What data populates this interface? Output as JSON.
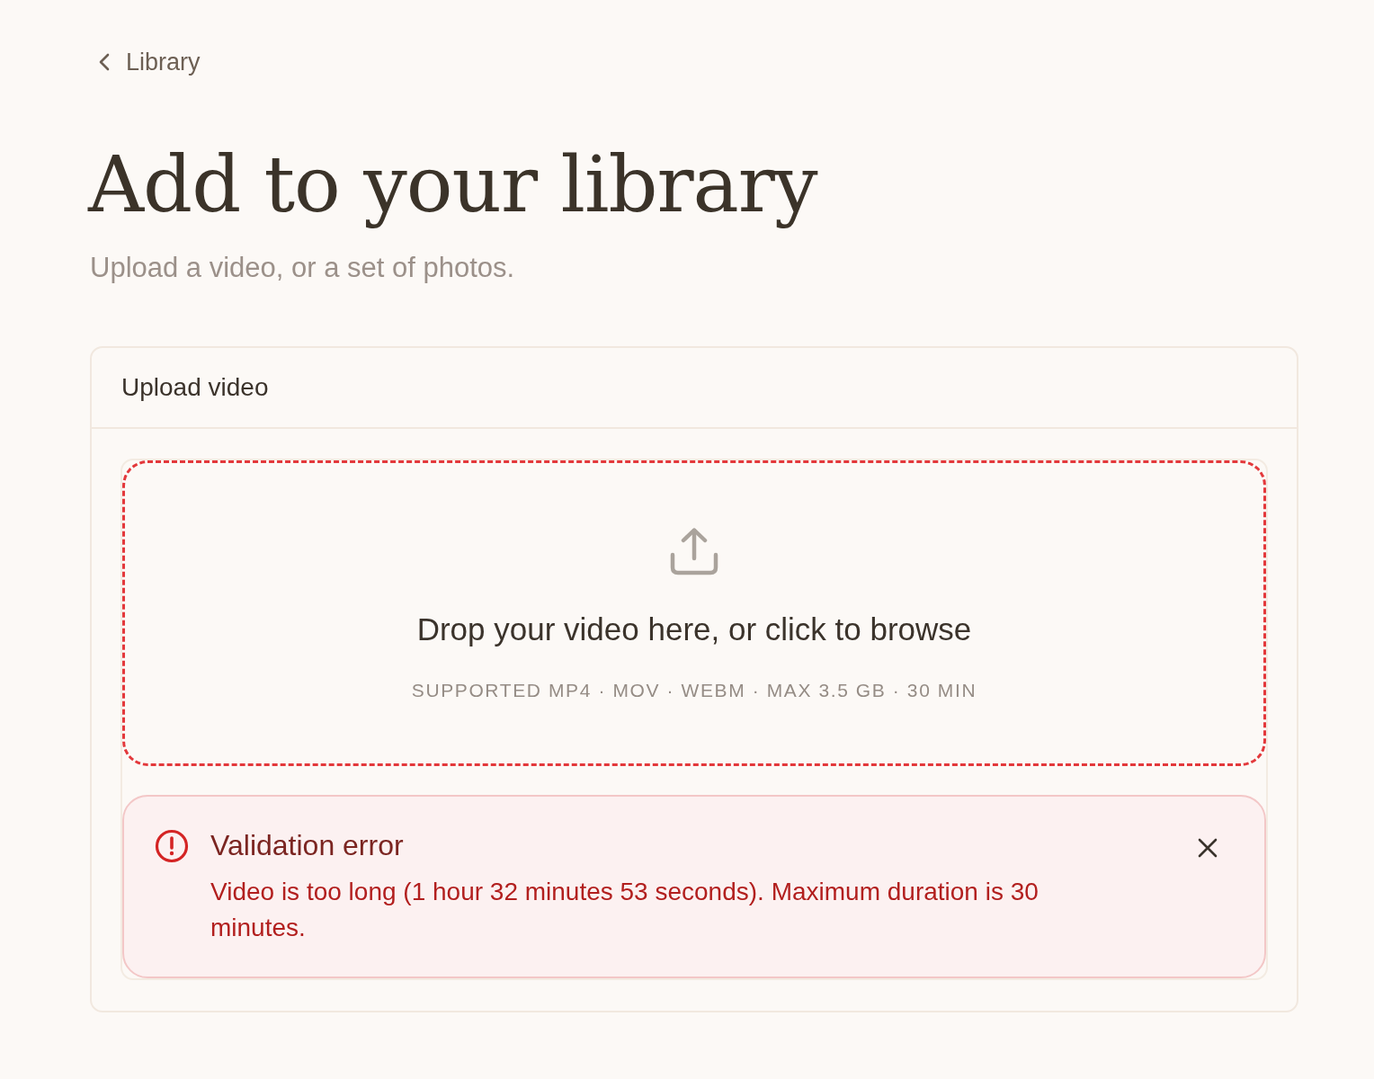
{
  "back_link": {
    "label": "Library"
  },
  "page": {
    "title": "Add to your library",
    "subtitle": "Upload a video, or a set of photos."
  },
  "upload_card": {
    "title": "Upload video",
    "dropzone": {
      "prompt": "Drop your video here, or click to browse",
      "formats": "SUPPORTED MP4 · MOV · WEBM · MAX 3.5 GB · 30 MIN",
      "error": true
    },
    "alert": {
      "kind": "error",
      "title": "Validation error",
      "message": "Video is too long (1 hour 32 minutes 53 seconds). Maximum duration is 30 minutes.",
      "dismissible": true
    }
  }
}
